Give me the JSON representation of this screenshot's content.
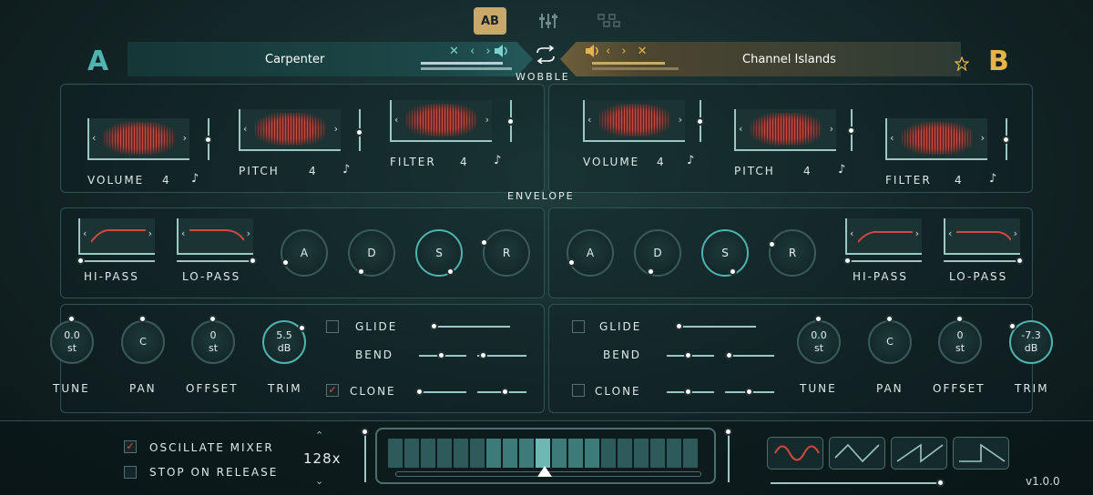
{
  "toolbar": {
    "ab_label": "AB",
    "mixer_icon": "mixer-icon",
    "grid_icon": "grid-icon"
  },
  "slotA": {
    "letter": "A",
    "preset": "Carpenter",
    "nav_controls": "✕ ‹ ›"
  },
  "slotB": {
    "letter": "B",
    "preset": "Channel Islands",
    "nav_controls": "‹ › ✕"
  },
  "sections": {
    "wobble": "WOBBLE",
    "envelope": "ENVELOPE"
  },
  "wobble": {
    "a": [
      {
        "label": "VOLUME",
        "value": "4"
      },
      {
        "label": "PITCH",
        "value": "4"
      },
      {
        "label": "FILTER",
        "value": "4"
      }
    ],
    "b": [
      {
        "label": "VOLUME",
        "value": "4"
      },
      {
        "label": "PITCH",
        "value": "4"
      },
      {
        "label": "FILTER",
        "value": "4"
      }
    ],
    "note_symbol": "♪"
  },
  "envelope": {
    "hipass": "HI-PASS",
    "lopass": "LO-PASS",
    "adsr": [
      "A",
      "D",
      "S",
      "R"
    ]
  },
  "controls": {
    "a": {
      "tune": "0.0",
      "tune_unit": "st",
      "pan": "C",
      "offset": "0",
      "offset_unit": "st",
      "trim": "5.5",
      "trim_unit": "dB"
    },
    "b": {
      "tune": "0.0",
      "tune_unit": "st",
      "pan": "C",
      "offset": "0",
      "offset_unit": "st",
      "trim": "-7.3",
      "trim_unit": "dB"
    },
    "labels": {
      "tune": "TUNE",
      "pan": "PAN",
      "offset": "OFFSET",
      "trim": "TRIM"
    },
    "glide": "GLIDE",
    "bend": "BEND",
    "clone": "CLONE",
    "a_clone_checked": true,
    "b_clone_checked": false
  },
  "bottom": {
    "oscillate_mixer": "OSCILLATE MIXER",
    "stop_on_release": "STOP ON RELEASE",
    "rate": "128x",
    "version": "v1.0.0",
    "oscillate_checked": true,
    "stop_checked": false,
    "shapes": [
      "sine-wave-icon",
      "triangle-wave-icon",
      "saw-up-wave-icon",
      "saw-down-wave-icon"
    ]
  },
  "colors": {
    "accent_teal": "#4fb3b1",
    "accent_gold": "#e5b54a",
    "wave_red": "#d0483e"
  }
}
